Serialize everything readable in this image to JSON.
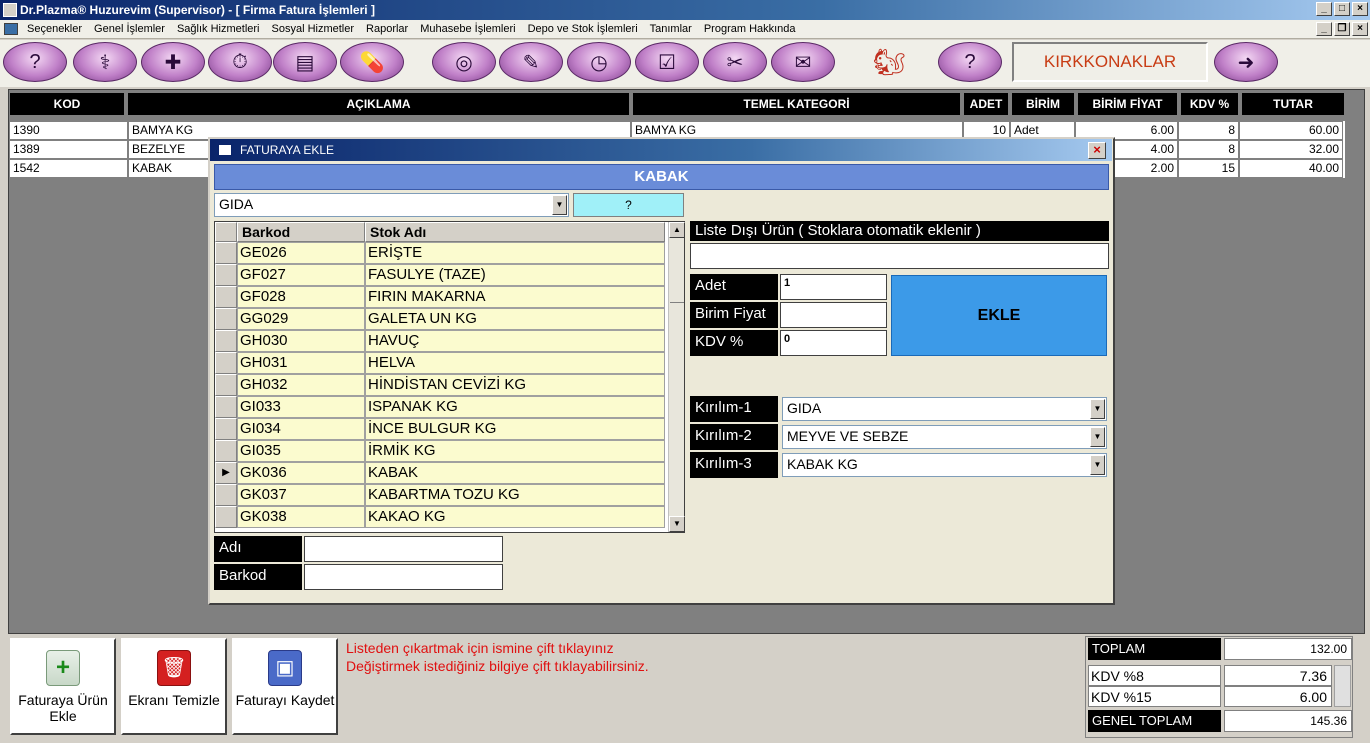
{
  "window": {
    "title": "Dr.Plazma® Huzurevim (Supervisor) - [ Firma Fatura İşlemleri ]"
  },
  "menu": [
    "Seçenekler",
    "Genel İşlemler",
    "Sağlık Hizmetleri",
    "Sosyal Hizmetler",
    "Raporlar",
    "Muhasebe İşlemleri",
    "Depo ve Stok İşlemleri",
    "Tanımlar",
    "Program Hakkında"
  ],
  "toolbar": {
    "brand": "KIRKKONAKLAR"
  },
  "invoice": {
    "columns": [
      "KOD",
      "AÇIKLAMA",
      "TEMEL KATEGORİ",
      "ADET",
      "BİRİM",
      "BİRİM FİYAT",
      "KDV %",
      "TUTAR"
    ],
    "rows": [
      {
        "kod": "1390",
        "aciklama": "BAMYA KG",
        "kategori": "BAMYA KG",
        "adet": "10",
        "birim": "Adet",
        "fiyat": "6.00",
        "kdv": "8",
        "tutar": "60.00"
      },
      {
        "kod": "1389",
        "aciklama": "BEZELYE",
        "kategori": "",
        "adet": "",
        "birim": "",
        "fiyat": "4.00",
        "kdv": "8",
        "tutar": "32.00"
      },
      {
        "kod": "1542",
        "aciklama": "KABAK",
        "kategori": "",
        "adet": "",
        "birim": "",
        "fiyat": "2.00",
        "kdv": "15",
        "tutar": "40.00"
      }
    ]
  },
  "dialog": {
    "title": "FATURAYA EKLE",
    "header": "KABAK",
    "category": "GIDA",
    "help_button": "?",
    "stock_headers": [
      "Barkod",
      "Stok Adı"
    ],
    "stock": [
      {
        "barkod": "GE026",
        "ad": "ERİŞTE"
      },
      {
        "barkod": "GF027",
        "ad": "FASULYE (TAZE)"
      },
      {
        "barkod": "GF028",
        "ad": "FIRIN MAKARNA"
      },
      {
        "barkod": "GG029",
        "ad": "GALETA UN KG"
      },
      {
        "barkod": "GH030",
        "ad": "HAVUÇ"
      },
      {
        "barkod": "GH031",
        "ad": "HELVA"
      },
      {
        "barkod": "GH032",
        "ad": "HİNDİSTAN CEVİZİ KG"
      },
      {
        "barkod": "GI033",
        "ad": "ISPANAK KG"
      },
      {
        "barkod": "GI034",
        "ad": "İNCE BULGUR KG"
      },
      {
        "barkod": "GI035",
        "ad": "İRMİK KG"
      },
      {
        "barkod": "GK036",
        "ad": "KABAK"
      },
      {
        "barkod": "GK037",
        "ad": "KABARTMA TOZU KG"
      },
      {
        "barkod": "GK038",
        "ad": "KAKAO KG"
      }
    ],
    "selected_row": 10,
    "search": {
      "adi_label": "Adı",
      "barkod_label": "Barkod",
      "adi_value": "",
      "barkod_value": ""
    },
    "off_list_label": "Liste Dışı Ürün ( Stoklara otomatik eklenir )",
    "off_list_value": "",
    "adet_label": "Adet",
    "adet_value": "1",
    "fiyat_label": "Birim Fiyat",
    "fiyat_value": "",
    "kdv_label": "KDV %",
    "kdv_value": "0",
    "add_button": "EKLE",
    "kirilim": [
      {
        "label": "Kırılım-1",
        "value": "GIDA"
      },
      {
        "label": "Kırılım-2",
        "value": "MEYVE VE SEBZE"
      },
      {
        "label": "Kırılım-3",
        "value": "KABAK KG"
      }
    ]
  },
  "bottom": {
    "buttons": [
      {
        "label": "Faturaya Ürün Ekle",
        "icon": "add-document-icon"
      },
      {
        "label": "Ekranı Temizle",
        "icon": "trash-icon"
      },
      {
        "label": "Faturayı Kaydet",
        "icon": "floppy-disk-icon"
      }
    ],
    "hints": [
      "Listeden çıkartmak için ismine çift tıklayınız",
      "Değiştirmek istediğiniz bilgiye çift tıklayabilirsiniz."
    ],
    "totals": {
      "toplam_label": "TOPLAM",
      "toplam": "132.00",
      "kdv8_label": "KDV %8",
      "kdv8": "7.36",
      "kdv15_label": "KDV %15",
      "kdv15": "6.00",
      "genel_label": "GENEL TOPLAM",
      "genel": "145.36"
    }
  },
  "colors": {
    "accent": "#6a8cd8",
    "add_button": "#3c9ae8",
    "hint_text": "#e01010",
    "brand_text": "#c83c14"
  }
}
